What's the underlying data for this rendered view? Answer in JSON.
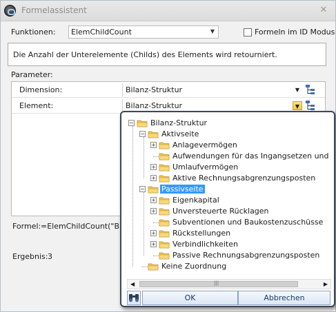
{
  "window": {
    "title": "Formelassistent",
    "close_glyph": "✕"
  },
  "funktionen": {
    "label": "Funktionen:",
    "value": "ElemChildCount"
  },
  "id_mode": {
    "label": "Formeln im ID Modus",
    "checked": false
  },
  "description": "Die Anzahl der Unterelemente (Childs) des Elements wird retourniert.",
  "parameter": {
    "label": "Parameter:",
    "rows": [
      {
        "name": "Dimension:",
        "value": "Bilanz-Struktur"
      },
      {
        "name": "Element:",
        "value": "Bilanz-Struktur"
      }
    ]
  },
  "formel": {
    "label": "Formel:",
    "value": "=ElemChildCount(\"Bilan"
  },
  "ergebnis": {
    "label": "Ergebnis:",
    "value": "3"
  },
  "popup": {
    "tree": [
      {
        "label": "Bilanz-Struktur",
        "level": 0,
        "expander": "−"
      },
      {
        "label": "Aktivseite",
        "level": 1,
        "expander": "−"
      },
      {
        "label": "Anlagevermögen",
        "level": 2,
        "expander": "+"
      },
      {
        "label": "Aufwendungen für das Ingangsetzen und Erw",
        "level": 2,
        "expander": ""
      },
      {
        "label": "Umlaufvermögen",
        "level": 2,
        "expander": "+"
      },
      {
        "label": "Aktive Rechnungsabgrenzungsposten",
        "level": 2,
        "expander": "+"
      },
      {
        "label": "Passivseite",
        "level": 1,
        "expander": "−",
        "selected": true
      },
      {
        "label": "Eigenkapital",
        "level": 2,
        "expander": "+"
      },
      {
        "label": "Unversteuerte Rücklagen",
        "level": 2,
        "expander": "+"
      },
      {
        "label": "Subventionen und Baukostenzuschüsse",
        "level": 2,
        "expander": ""
      },
      {
        "label": "Rückstellungen",
        "level": 2,
        "expander": "+"
      },
      {
        "label": "Verbindlichkeiten",
        "level": 2,
        "expander": "+"
      },
      {
        "label": "Passive Rechnungsabgrenzungsposten",
        "level": 2,
        "expander": ""
      },
      {
        "label": "Keine Zuordnung",
        "level": 1,
        "expander": ""
      }
    ],
    "ok_label": "OK",
    "cancel_label": "Abbrechen",
    "scroll_thumb_glyph": "|||"
  },
  "colors": {
    "selection": "#3399ff",
    "folder": "#f2c54e",
    "popup_border": "#3e4654"
  },
  "icons": [
    "app-icon",
    "close-icon",
    "chevron-down-icon",
    "tree-hierarchy-icon",
    "folder-icon",
    "binoculars-icon"
  ]
}
